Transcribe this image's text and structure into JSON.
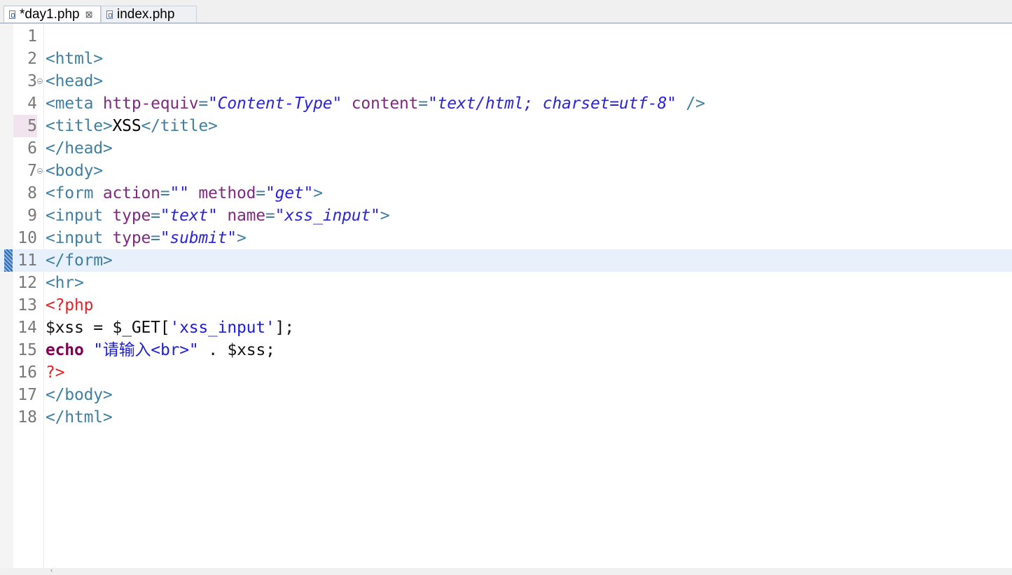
{
  "tabs": [
    {
      "label": "*day1.php",
      "active": true,
      "icon": "php-file-icon",
      "close": "⊠"
    },
    {
      "label": "index.php",
      "active": false,
      "icon": "php-file-icon"
    }
  ],
  "editor": {
    "current_line": 11,
    "lines": [
      {
        "num": "1",
        "tokens": []
      },
      {
        "num": "2",
        "tokens": [
          [
            "t",
            "<html>"
          ]
        ]
      },
      {
        "num": "3",
        "fold": true,
        "tokens": [
          [
            "t",
            "<head>"
          ]
        ]
      },
      {
        "num": "4",
        "tokens": [
          [
            "t",
            "<meta "
          ],
          [
            "an",
            "http-equiv"
          ],
          [
            "t",
            "="
          ],
          [
            "av",
            "\"Content-Type\""
          ],
          [
            "t",
            " "
          ],
          [
            "an",
            "content"
          ],
          [
            "t",
            "="
          ],
          [
            "av",
            "\"text/html; charset=utf-8\""
          ],
          [
            "t",
            " />"
          ]
        ]
      },
      {
        "num": "5",
        "mark": true,
        "tokens": [
          [
            "t",
            "<title>"
          ],
          [
            "tx",
            "XSS"
          ],
          [
            "t",
            "</title>"
          ]
        ]
      },
      {
        "num": "6",
        "tokens": [
          [
            "t",
            "</head>"
          ]
        ]
      },
      {
        "num": "7",
        "fold": true,
        "tokens": [
          [
            "t",
            "<body>"
          ]
        ]
      },
      {
        "num": "8",
        "tokens": [
          [
            "t",
            "<form "
          ],
          [
            "an",
            "action"
          ],
          [
            "t",
            "="
          ],
          [
            "av",
            "\"\""
          ],
          [
            "t",
            " "
          ],
          [
            "an",
            "method"
          ],
          [
            "t",
            "="
          ],
          [
            "av",
            "\"get\""
          ],
          [
            "t",
            ">"
          ]
        ]
      },
      {
        "num": "9",
        "tokens": [
          [
            "t",
            "<input "
          ],
          [
            "an",
            "type"
          ],
          [
            "t",
            "="
          ],
          [
            "av",
            "\"text\""
          ],
          [
            "t",
            " "
          ],
          [
            "an",
            "name"
          ],
          [
            "t",
            "="
          ],
          [
            "av",
            "\"xss_input\""
          ],
          [
            "t",
            ">"
          ]
        ]
      },
      {
        "num": "10",
        "tokens": [
          [
            "t",
            "<input "
          ],
          [
            "an",
            "type"
          ],
          [
            "t",
            "="
          ],
          [
            "av",
            "\"submit\""
          ],
          [
            "t",
            ">"
          ]
        ]
      },
      {
        "num": "11",
        "tokens": [
          [
            "t",
            "</form>"
          ]
        ]
      },
      {
        "num": "12",
        "tokens": [
          [
            "t",
            "<hr>"
          ]
        ]
      },
      {
        "num": "13",
        "tokens": [
          [
            "ph",
            "<?php"
          ]
        ]
      },
      {
        "num": "14",
        "tokens": [
          [
            "vr",
            "$xss"
          ],
          [
            "op",
            " = "
          ],
          [
            "vr",
            "$_GET"
          ],
          [
            "op",
            "["
          ],
          [
            "st",
            "'xss_input'"
          ],
          [
            "op",
            "];"
          ]
        ]
      },
      {
        "num": "15",
        "tokens": [
          [
            "kw",
            "echo"
          ],
          [
            "op",
            " "
          ],
          [
            "st",
            "\"请输入<br>\""
          ],
          [
            "op",
            " . "
          ],
          [
            "vr",
            "$xss"
          ],
          [
            "op",
            ";"
          ]
        ]
      },
      {
        "num": "16",
        "tokens": [
          [
            "ph",
            "?>"
          ]
        ]
      },
      {
        "num": "17",
        "tokens": [
          [
            "t",
            "</body>"
          ]
        ]
      },
      {
        "num": "18",
        "tokens": [
          [
            "t",
            "</html>"
          ]
        ]
      }
    ]
  },
  "bottom_mark": "‹"
}
